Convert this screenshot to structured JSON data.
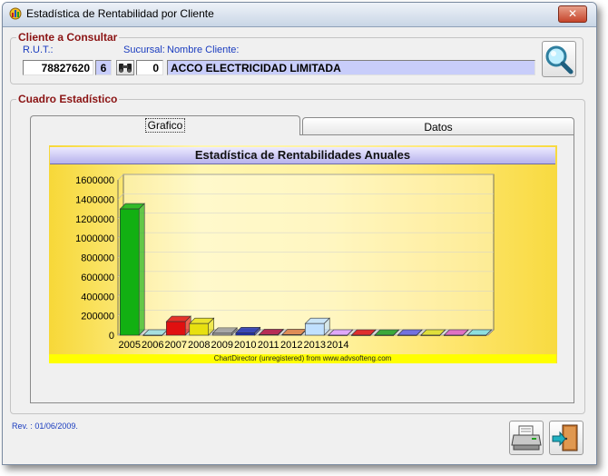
{
  "window": {
    "title": "Estadística de Rentabilidad por Cliente",
    "close_label": "✕"
  },
  "cliente": {
    "legend": "Cliente a Consultar",
    "rut_label": "R.U.T.:",
    "rut_value": "78827620",
    "dv_value": "6",
    "sucursal_label": "Sucursal:",
    "sucursal_value": "0",
    "nombre_label": "Nombre Cliente:",
    "nombre_value": "ACCO ELECTRICIDAD LIMITADA"
  },
  "cuadro": {
    "legend": "Cuadro Estadístico"
  },
  "tabs": [
    {
      "label": "Grafico",
      "active": true
    },
    {
      "label": "Datos",
      "active": false
    }
  ],
  "footer": {
    "rev": "Rev. : 01/06/2009."
  },
  "chart_data": {
    "type": "bar",
    "title": "Estadística de Rentabilidades Anuales",
    "footer_note": "ChartDirector (unregistered) from www.advsofteng.com",
    "categories": [
      "2005",
      "2006",
      "2007",
      "2008",
      "2009",
      "2010",
      "2011",
      "2012",
      "2013",
      "2014",
      "",
      "",
      "",
      "",
      "",
      ""
    ],
    "values": [
      1300000,
      0,
      140000,
      120000,
      20000,
      25000,
      5000,
      5000,
      120000,
      0,
      0,
      0,
      0,
      0,
      0,
      0
    ],
    "colors": [
      "#12b012",
      "#9ee0e0",
      "#e01010",
      "#e8e010",
      "#a0a0a0",
      "#2030b0",
      "#b01040",
      "#e08040",
      "#c0e0ff",
      "#e0a0ff",
      "#e01010",
      "#20a020",
      "#6060e0",
      "#e0e020",
      "#e060c0",
      "#80e0e0"
    ],
    "ylim": [
      0,
      1600000
    ],
    "yticks": [
      "1600000",
      "1400000",
      "1200000",
      "1000000",
      "800000",
      "600000",
      "400000",
      "200000",
      "0"
    ],
    "grid": true
  }
}
